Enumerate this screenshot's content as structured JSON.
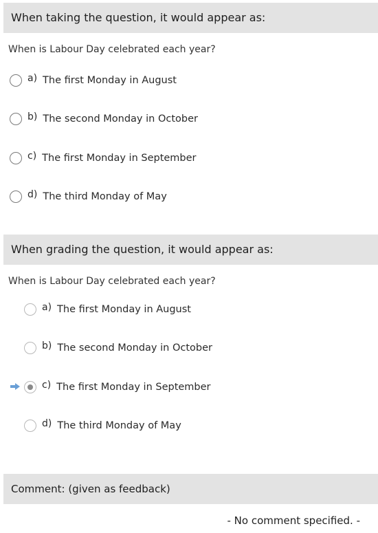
{
  "taking": {
    "header": "When taking the question, it would appear as:",
    "question": "When is Labour Day celebrated each year?",
    "options": [
      {
        "letter": "a)",
        "text": "The first Monday in August"
      },
      {
        "letter": "b)",
        "text": "The second Monday in October"
      },
      {
        "letter": "c)",
        "text": "The first Monday in September"
      },
      {
        "letter": "d)",
        "text": "The third Monday of May"
      }
    ]
  },
  "grading": {
    "header": "When grading the question, it would appear as:",
    "question": "When is Labour Day celebrated each year?",
    "options": [
      {
        "letter": "a)",
        "text": "The first Monday in August",
        "selected": false
      },
      {
        "letter": "b)",
        "text": "The second Monday in October",
        "selected": false
      },
      {
        "letter": "c)",
        "text": "The first Monday in September",
        "selected": true
      },
      {
        "letter": "d)",
        "text": "The third Monday of May",
        "selected": false
      }
    ],
    "correct_indicator_icon": "arrow-right-icon"
  },
  "comment": {
    "label": "Comment:",
    "note": "(given as feedback)",
    "value": "- No comment specified. -"
  },
  "colors": {
    "band_background": "#e3e3e3",
    "indicator_arrow": "#6a9fd6"
  }
}
